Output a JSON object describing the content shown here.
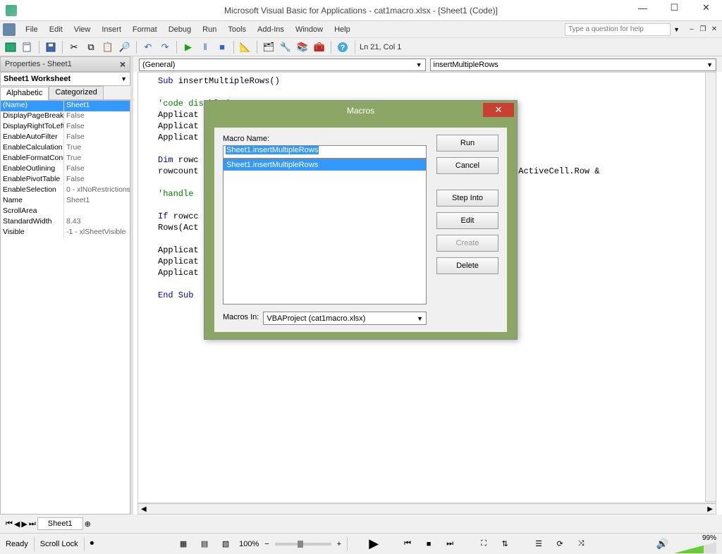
{
  "titlebar": {
    "title": "Microsoft Visual Basic for Applications - cat1macro.xlsx - [Sheet1 (Code)]"
  },
  "menubar": {
    "items": [
      "File",
      "Edit",
      "View",
      "Insert",
      "Format",
      "Debug",
      "Run",
      "Tools",
      "Add-Ins",
      "Window",
      "Help"
    ],
    "help_placeholder": "Type a question for help"
  },
  "toolbar": {
    "status": "Ln 21, Col 1"
  },
  "properties": {
    "title": "Properties - Sheet1",
    "object": "Sheet1 Worksheet",
    "tabs": [
      "Alphabetic",
      "Categorized"
    ],
    "rows": [
      {
        "name": "(Name)",
        "val": "Sheet1",
        "sel": true
      },
      {
        "name": "DisplayPageBreaks",
        "val": "False"
      },
      {
        "name": "DisplayRightToLeft",
        "val": "False"
      },
      {
        "name": "EnableAutoFilter",
        "val": "False"
      },
      {
        "name": "EnableCalculation",
        "val": "True"
      },
      {
        "name": "EnableFormatConditionsCalculation",
        "val": "True"
      },
      {
        "name": "EnableOutlining",
        "val": "False"
      },
      {
        "name": "EnablePivotTable",
        "val": "False"
      },
      {
        "name": "EnableSelection",
        "val": "0 - xlNoRestrictions"
      },
      {
        "name": "Name",
        "val": "Sheet1"
      },
      {
        "name": "ScrollArea",
        "val": ""
      },
      {
        "name": "StandardWidth",
        "val": "8.43"
      },
      {
        "name": "Visible",
        "val": "-1 - xlSheetVisible"
      }
    ]
  },
  "code": {
    "object_dd": "(General)",
    "proc_dd": "insertMultipleRows",
    "lines": [
      {
        "t": "Sub insertMultipleRows()",
        "c": "kw-sub"
      },
      {
        "t": ""
      },
      {
        "t": "'code disabled",
        "c": "cm"
      },
      {
        "t": "Applicat"
      },
      {
        "t": "Applicat"
      },
      {
        "t": "Applicat"
      },
      {
        "t": ""
      },
      {
        "t": "Dim rowc",
        "c": "kw-dim"
      },
      {
        "t": "rowcount                                              ant to insert\" & ActiveCell.Row &"
      },
      {
        "t": ""
      },
      {
        "t": "'handle                                                ero'",
        "c": "cm"
      },
      {
        "t": ""
      },
      {
        "t": "If rowcc",
        "c": "kw-if"
      },
      {
        "t": "Rows(Act                                              rt Shift:=xlDown"
      },
      {
        "t": ""
      },
      {
        "t": "Applicat"
      },
      {
        "t": "Applicat"
      },
      {
        "t": "Applicat"
      },
      {
        "t": ""
      },
      {
        "t": "End Sub",
        "c": "kw-end"
      }
    ]
  },
  "modal": {
    "title": "Macros",
    "name_label": "Macro Name:",
    "name_value": "Sheet1.insertMultipleRows",
    "list": [
      "Sheet1.insertMultipleRows"
    ],
    "in_label": "Macros In:",
    "in_value": "VBAProject (cat1macro.xlsx)",
    "buttons": [
      "Run",
      "Cancel",
      "Step Into",
      "Edit",
      "Create",
      "Delete"
    ]
  },
  "sheets": {
    "tab": "Sheet1"
  },
  "statusbar": {
    "ready": "Ready",
    "scroll": "Scroll Lock",
    "zoom": "100%",
    "volume": "99%"
  }
}
